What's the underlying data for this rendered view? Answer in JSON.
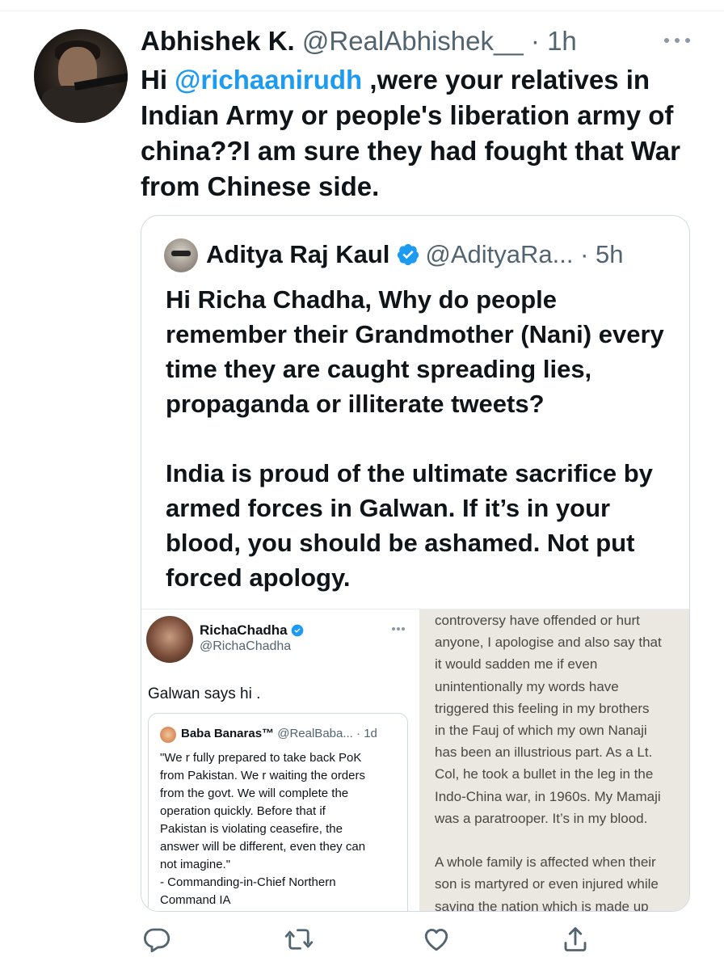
{
  "tweet": {
    "author_name": "Abhishek K.",
    "author_handle": "@RealAbhishek__",
    "time": "1h",
    "text_prefix": "Hi",
    "mention": "@richaanirudh",
    "text_body": ",were your relatives in Indian Army or people's liberation army of china??I am sure they had fought that War from Chinese side."
  },
  "quoted_tweet": {
    "author_name": "Aditya Raj Kaul",
    "author_handle": "@AdityaRa...",
    "time": "5h",
    "paragraph_1": "Hi Richa Chadha, Why do people remember their Grandmother (Nani) every time they are caught spreading lies, propaganda or illiterate tweets?",
    "paragraph_2": "India is proud of the ultimate sacrifice by armed forces in Galwan. If it’s in your blood, you should be ashamed. Not put forced apology."
  },
  "media_left": {
    "author_name": "RichaChadha",
    "author_handle": "@RichaChadha",
    "text": "Galwan says hi .",
    "inner_quote": {
      "author_name": "Baba Banaras™",
      "author_handle": "@RealBaba...",
      "time": "1d",
      "lines": [
        "\"We r fully prepared to take back PoK",
        "from Pakistan. We r waiting the orders",
        "from the govt. We will complete the",
        "operation quickly. Before that if",
        "Pakistan is violating ceasefire, the",
        "answer will be different, even they can",
        "not imagine.\"",
        "- Commanding-in-Chief Northern",
        "Command IA"
      ]
    }
  },
  "media_right": {
    "lines": [
      "controversy have offended or hurt",
      "anyone, I apologise and also say that",
      "it would sadden me if even",
      "unintentionally my words have",
      "triggered this feeling in my brothers",
      "in the Fauj of which my own Nanaji",
      "has been an illustrious part. As a Lt.",
      "Col, he took a bullet in the leg in the",
      "Indo-China war, in 1960s. My Mamaji",
      "was a paratrooper. It’s in my blood.",
      "",
      "A whole family is affected when their",
      "son is martyred or even injured while",
      "saving the nation which is made up"
    ]
  },
  "actions": [
    {
      "icon": "reply-icon"
    },
    {
      "icon": "retweet-icon"
    },
    {
      "icon": "like-icon"
    },
    {
      "icon": "share-icon"
    }
  ],
  "colors": {
    "accent": "#1d9bf0",
    "text": "#0f1419",
    "secondary": "#536471",
    "border": "#cfd9de",
    "action_icon": "#536471"
  }
}
